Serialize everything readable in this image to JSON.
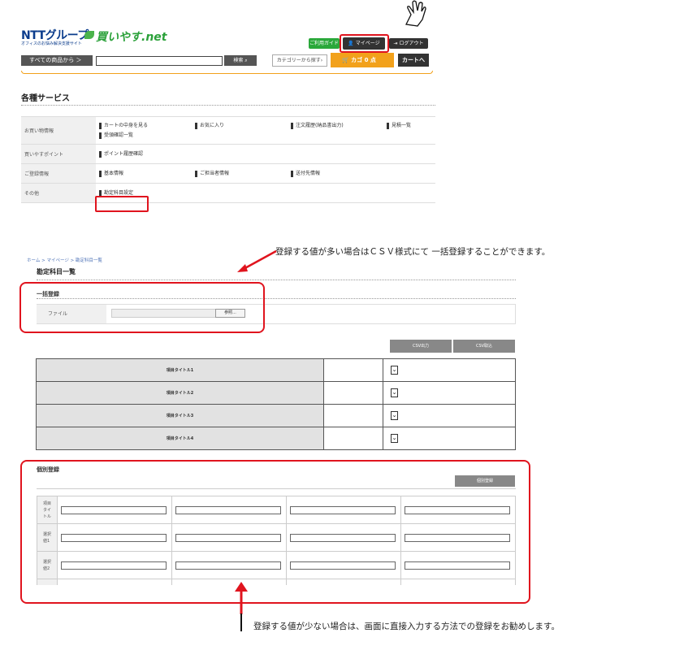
{
  "header": {
    "logo_main": "NTTグループ",
    "logo_sub": "オフィスのお悩み解決支援サイト",
    "logo_brand": "買いやす.net",
    "guide_label": "ご利用ガイド",
    "mypage_label": "マイページ",
    "logout_label": "ログアウト",
    "allproducts_label": "すべての商品から ＞",
    "search_value": "",
    "search_button": "検索",
    "category_label": "カテゴリーから探す",
    "cart_label": "カゴ 0 点",
    "cart_go_label": "カートへ"
  },
  "services": {
    "title": "各種サービス",
    "rows": [
      {
        "head": "お買い物情報",
        "links": [
          "カートの中身を見る",
          "お気に入り",
          "注文履歴(納品書出力)",
          "見積一覧",
          "受領確認一覧"
        ]
      },
      {
        "head": "買いやすポイント",
        "links": [
          "ポイント履歴確認"
        ]
      },
      {
        "head": "ご登録情報",
        "links": [
          "基本情報",
          "ご担当者情報",
          "送付先情報"
        ]
      },
      {
        "head": "その他",
        "links": [
          "勘定科目設定"
        ]
      }
    ]
  },
  "annotations": {
    "note_bulk": "登録する値が多い場合はＣＳＶ様式にて 一括登録することができます。",
    "note_individual": "登録する値が少ない場合は、画面に直接入力する方法での登録をお勧めします。"
  },
  "account_page": {
    "breadcrumb": "ホーム > マイページ > 勘定科目一覧",
    "title": "勘定科目一覧",
    "bulk_title": "一括登録",
    "file_label": "ファイル",
    "browse_label": "参照...",
    "csv_out_label": "CSV出力",
    "csv_in_label": "CSV取込",
    "item_titles": [
      "項目タイトル1",
      "項目タイトル2",
      "項目タイトル3",
      "項目タイトル4"
    ],
    "individual_title": "個別登録",
    "individual_button": "個別登録",
    "grid_rows": [
      {
        "label": "項目タイトル"
      },
      {
        "label": "選択値1"
      },
      {
        "label": "選択値2"
      },
      {
        "label": "選択"
      }
    ]
  },
  "colors": {
    "highlight": "#e0141e",
    "accent_orange": "#f2a11b",
    "brand_green": "#2aa83a",
    "brand_blue": "#0b3c8c"
  }
}
